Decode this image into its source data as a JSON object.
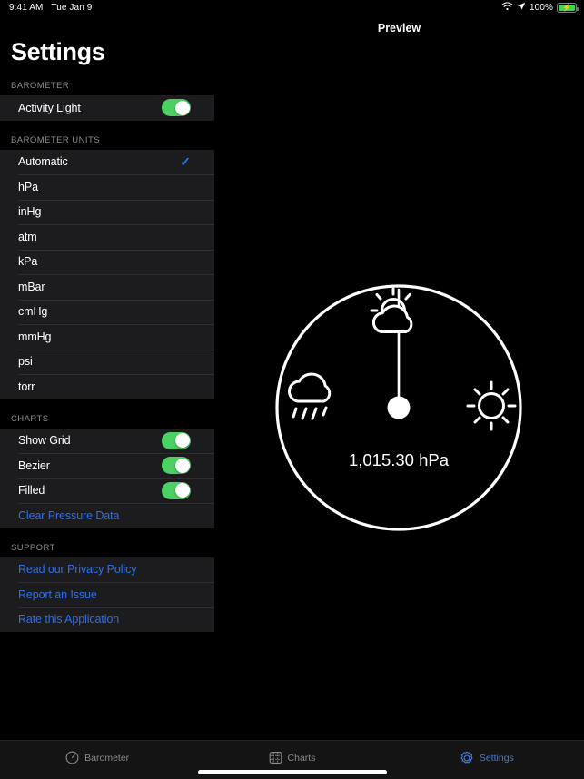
{
  "status_bar": {
    "time": "9:41 AM",
    "date": "Tue Jan 9",
    "wifi_icon": "wifi-icon",
    "location_icon": "location-arrow-icon",
    "battery_percent": "100%",
    "battery_icon": "battery-charging-icon",
    "battery_color": "#3ad84a"
  },
  "sidebar": {
    "title": "Settings",
    "sections": [
      {
        "header": "BAROMETER",
        "rows": [
          {
            "label": "Activity Light",
            "type": "toggle",
            "value": "on"
          }
        ]
      },
      {
        "header": "BAROMETER UNITS",
        "rows": [
          {
            "label": "Automatic",
            "type": "check",
            "value": "selected"
          },
          {
            "label": "hPa",
            "type": "plain",
            "value": ""
          },
          {
            "label": "inHg",
            "type": "plain",
            "value": ""
          },
          {
            "label": "atm",
            "type": "plain",
            "value": ""
          },
          {
            "label": "kPa",
            "type": "plain",
            "value": ""
          },
          {
            "label": "mBar",
            "type": "plain",
            "value": ""
          },
          {
            "label": "cmHg",
            "type": "plain",
            "value": ""
          },
          {
            "label": "mmHg",
            "type": "plain",
            "value": ""
          },
          {
            "label": "psi",
            "type": "plain",
            "value": ""
          },
          {
            "label": "torr",
            "type": "plain",
            "value": ""
          }
        ]
      },
      {
        "header": "CHARTS",
        "rows": [
          {
            "label": "Show Grid",
            "type": "toggle",
            "value": "on"
          },
          {
            "label": "Bezier",
            "type": "toggle",
            "value": "on"
          },
          {
            "label": "Filled",
            "type": "toggle",
            "value": "on"
          },
          {
            "label": "Clear Pressure Data",
            "type": "link",
            "value": ""
          }
        ]
      },
      {
        "header": "SUPPORT",
        "rows": [
          {
            "label": "Read our Privacy Policy",
            "type": "link",
            "value": ""
          },
          {
            "label": "Report an Issue",
            "type": "link",
            "value": ""
          },
          {
            "label": "Rate this Application",
            "type": "link",
            "value": ""
          }
        ]
      }
    ]
  },
  "preview": {
    "title": "Preview",
    "gauge": {
      "reading": "1,015.30 hPa",
      "needle_direction": "up",
      "icons": {
        "left": "rain-cloud-icon",
        "top": "sun-behind-cloud-icon",
        "right": "sun-icon"
      },
      "stroke_color": "#ffffff"
    }
  },
  "tab_bar": {
    "tabs": [
      {
        "label": "Barometer",
        "icon": "gauge-icon",
        "active": false
      },
      {
        "label": "Charts",
        "icon": "chart-grid-icon",
        "active": false
      },
      {
        "label": "Settings",
        "icon": "gear-icon",
        "active": true
      }
    ],
    "active_color": "#3f7ce8",
    "inactive_color": "#8a8a8e"
  }
}
